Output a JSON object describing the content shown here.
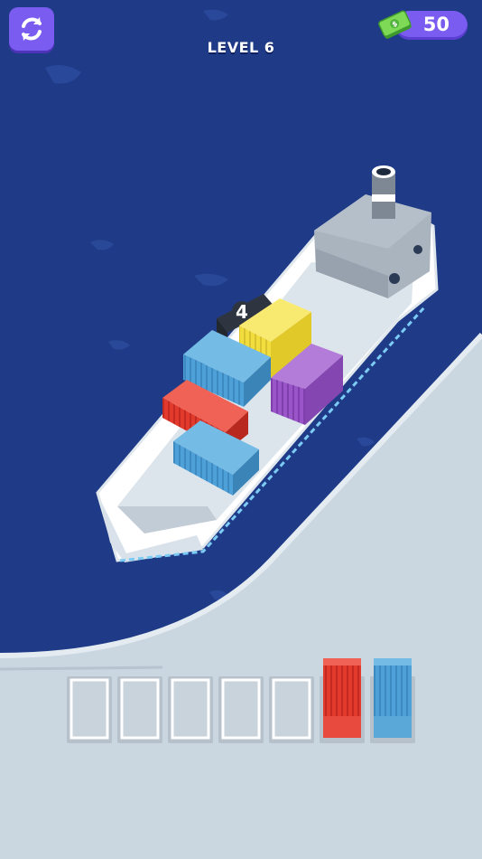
{
  "hud": {
    "level_label": "LEVEL 6",
    "cash_amount": "50"
  },
  "icons": {
    "restart": "restart-arrows-icon",
    "cash": "cash-money-icon"
  },
  "ship": {
    "stack_count": "4",
    "containers": [
      {
        "color": "yellow"
      },
      {
        "color": "blue"
      },
      {
        "color": "purple"
      },
      {
        "color": "red"
      },
      {
        "color": "blue"
      }
    ]
  },
  "dock": {
    "slots": [
      {
        "filled": false
      },
      {
        "filled": false
      },
      {
        "filled": false
      },
      {
        "filled": false
      },
      {
        "filled": false
      },
      {
        "filled": true,
        "color": "red"
      },
      {
        "filled": true,
        "color": "blue"
      }
    ]
  },
  "colors": {
    "water": "#1f3b87",
    "land": "#cad6e0",
    "accent": "#7a5cf0",
    "red": "#e23b2e",
    "blue": "#4ea1d8",
    "yellow": "#f2dd3e",
    "purple": "#9a55c8"
  }
}
